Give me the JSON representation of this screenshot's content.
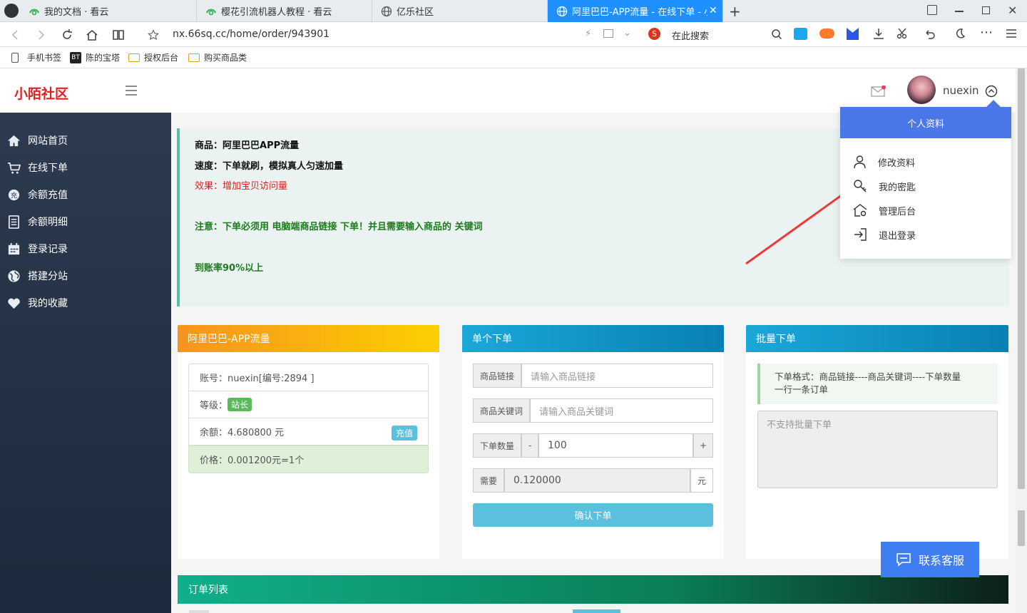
{
  "browser": {
    "tabs": [
      {
        "title": "我的文档 · 看云"
      },
      {
        "title": "樱花引流机器人教程 · 看云"
      },
      {
        "title": "亿乐社区"
      },
      {
        "title": "阿里巴巴-APP流量 - 在线下单 - 小陌"
      }
    ],
    "url": "nx.66sq.cc/home/order/943901",
    "search_label": "在此搜索",
    "bookmarks": [
      {
        "label": "手机书签"
      },
      {
        "label": "陈的宝塔",
        "badge": "BT"
      },
      {
        "label": "授权后台"
      },
      {
        "label": "购买商品类"
      }
    ]
  },
  "app": {
    "brand": "小陌社区",
    "username": "nuexin",
    "accent": "#e02020",
    "sidebar": [
      {
        "label": "网站首页",
        "icon": "home-icon"
      },
      {
        "label": "在线下单",
        "icon": "cart-icon"
      },
      {
        "label": "余额充值",
        "icon": "recharge-icon"
      },
      {
        "label": "余额明细",
        "icon": "ledger-icon"
      },
      {
        "label": "登录记录",
        "icon": "calendar-icon"
      },
      {
        "label": "搭建分站",
        "icon": "globe-icon"
      },
      {
        "label": "我的收藏",
        "icon": "heart-icon"
      }
    ],
    "notice": {
      "line1_label": "商品：",
      "line1_value": "阿里巴巴APP流量",
      "line2_label": "速度：",
      "line2_value": "下单就刷，模拟真人匀速加量",
      "line3": "效果：增加宝贝访问量",
      "line4": "注意：下单必须用 电脑端商品链接 下单！并且需要输入商品的 关键词",
      "line5": "到账率90%以上"
    },
    "product_card": {
      "title": "阿里巴巴-APP流量",
      "account": "账号：nuexin[编号:2894 ]",
      "level_label": "等级：",
      "level_badge": "站长",
      "balance": "余额：4.680800 元",
      "recharge_btn": "充值",
      "price": "价格：0.001200元=1个"
    },
    "single_order": {
      "title": "单个下单",
      "link_label": "商品链接",
      "link_placeholder": "请输入商品链接",
      "keyword_label": "商品关键词",
      "keyword_placeholder": "请输入商品关键词",
      "qty_label": "下单数量",
      "minus": "-",
      "qty_value": "100",
      "plus": "+",
      "need_label": "需要",
      "need_value": "0.120000",
      "need_unit": "元",
      "submit": "确认下单"
    },
    "batch_order": {
      "title": "批量下单",
      "hint_line1": "下单格式：商品链接----商品关键词----下单数量",
      "hint_line2": "一行一条订单",
      "textarea_placeholder": "不支持批量下单"
    },
    "order_list_title": "订单列表",
    "customer_service": "联系客服",
    "dropdown": {
      "header": "个人资料",
      "items": [
        {
          "label": "修改资料",
          "icon": "user-icon"
        },
        {
          "label": "我的密匙",
          "icon": "key-icon"
        },
        {
          "label": "管理后台",
          "icon": "admin-home-icon"
        },
        {
          "label": "退出登录",
          "icon": "logout-icon"
        }
      ]
    }
  }
}
